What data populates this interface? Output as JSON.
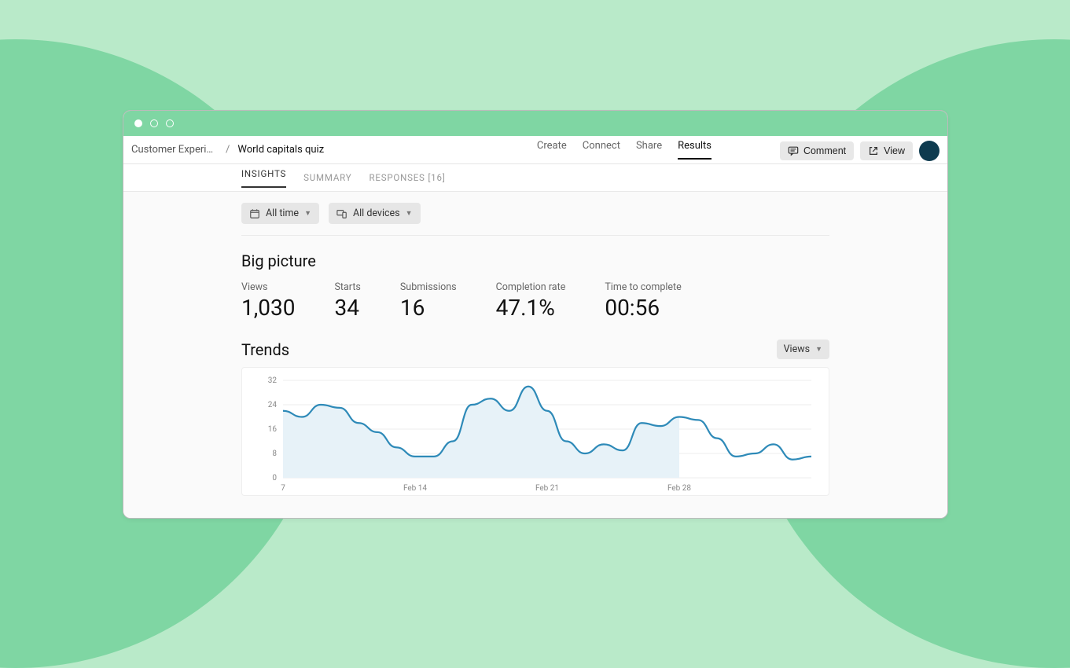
{
  "header": {
    "breadcrumb_parent": "Customer Experie…",
    "breadcrumb_sep": "/",
    "title": "World capitals quiz",
    "nav": {
      "create": "Create",
      "connect": "Connect",
      "share": "Share",
      "results": "Results"
    },
    "actions": {
      "comment": "Comment",
      "view": "View"
    }
  },
  "subnav": {
    "insights": "INSIGHTS",
    "summary": "SUMMARY",
    "responses": "RESPONSES [16]"
  },
  "filters": {
    "time": "All time",
    "devices": "All devices"
  },
  "big_picture": {
    "heading": "Big picture",
    "views": {
      "label": "Views",
      "value": "1,030"
    },
    "starts": {
      "label": "Starts",
      "value": "34"
    },
    "submissions": {
      "label": "Submissions",
      "value": "16"
    },
    "completion": {
      "label": "Completion rate",
      "value": "47.1%"
    },
    "time": {
      "label": "Time to complete",
      "value": "00:56"
    }
  },
  "trends": {
    "heading": "Trends",
    "selector": "Views"
  },
  "chart_data": {
    "type": "area",
    "title": "",
    "xlabel": "",
    "ylabel": "",
    "ylim": [
      0,
      32
    ],
    "yticks": [
      0,
      8,
      16,
      24,
      32
    ],
    "xticks_labels": [
      "7",
      "Feb 14",
      "Feb 21",
      "Feb 28"
    ],
    "xticks_index": [
      0,
      7,
      14,
      21
    ],
    "series": [
      {
        "name": "Views",
        "x": [
          0,
          1,
          2,
          3,
          4,
          5,
          6,
          7,
          8,
          9,
          10,
          11,
          12,
          13,
          14,
          15,
          16,
          17,
          18,
          19,
          20,
          21
        ],
        "values": [
          22,
          20,
          24,
          23,
          18,
          15,
          10,
          7,
          7,
          12,
          24,
          26,
          22,
          30,
          22,
          12,
          8,
          11,
          9,
          18,
          17,
          20
        ]
      },
      {
        "name": "Views",
        "x": [
          21,
          22,
          23,
          24,
          25,
          26,
          27,
          28
        ],
        "values": [
          20,
          19,
          13,
          7,
          8,
          11,
          6,
          7
        ]
      }
    ]
  }
}
